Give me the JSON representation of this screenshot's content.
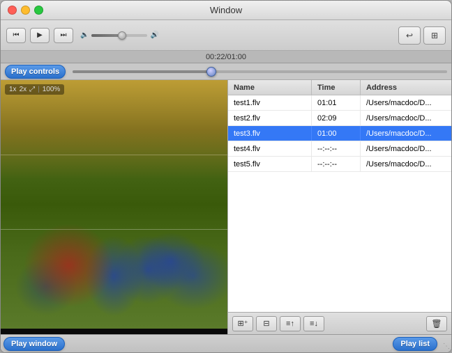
{
  "window": {
    "title": "Window"
  },
  "titlebar": {
    "close": "close",
    "minimize": "minimize",
    "maximize": "maximize"
  },
  "toolbar": {
    "rewind_label": "⏮",
    "play_label": "▶",
    "forward_label": "⏭",
    "volume_icon_left": "🔈",
    "volume_icon_right": "🔊",
    "btn1_icon": "↩",
    "btn2_icon": "⊞"
  },
  "progress": {
    "time_display": "00:22/01:00"
  },
  "play_controls_label": "Play controls",
  "video": {
    "zoom_1x": "1x",
    "zoom_2x": "2x",
    "zoom_fs": "⤢",
    "zoom_sep": "|",
    "zoom_pct": "100%"
  },
  "playlist": {
    "col_name": "Name",
    "col_time": "Time",
    "col_address": "Address",
    "items": [
      {
        "name": "test1.flv",
        "time": "01:01",
        "address": "/Users/macdoc/D...",
        "selected": false
      },
      {
        "name": "test2.flv",
        "time": "02:09",
        "address": "/Users/macdoc/D...",
        "selected": false
      },
      {
        "name": "test3.flv",
        "time": "01:00",
        "address": "/Users/macdoc/D...",
        "selected": true
      },
      {
        "name": "test4.flv",
        "time": "--:--:--",
        "address": "/Users/macdoc/D...",
        "selected": false
      },
      {
        "name": "test5.flv",
        "time": "--:--:--",
        "address": "/Users/macdoc/D...",
        "selected": false
      }
    ],
    "toolbar_btns": [
      "⊞+",
      "⊞-",
      "≡+",
      "≡-"
    ],
    "trash_icon": "🗑"
  },
  "bottom_bar": {
    "play_window_label": "Play window",
    "play_list_label": "Play list"
  }
}
